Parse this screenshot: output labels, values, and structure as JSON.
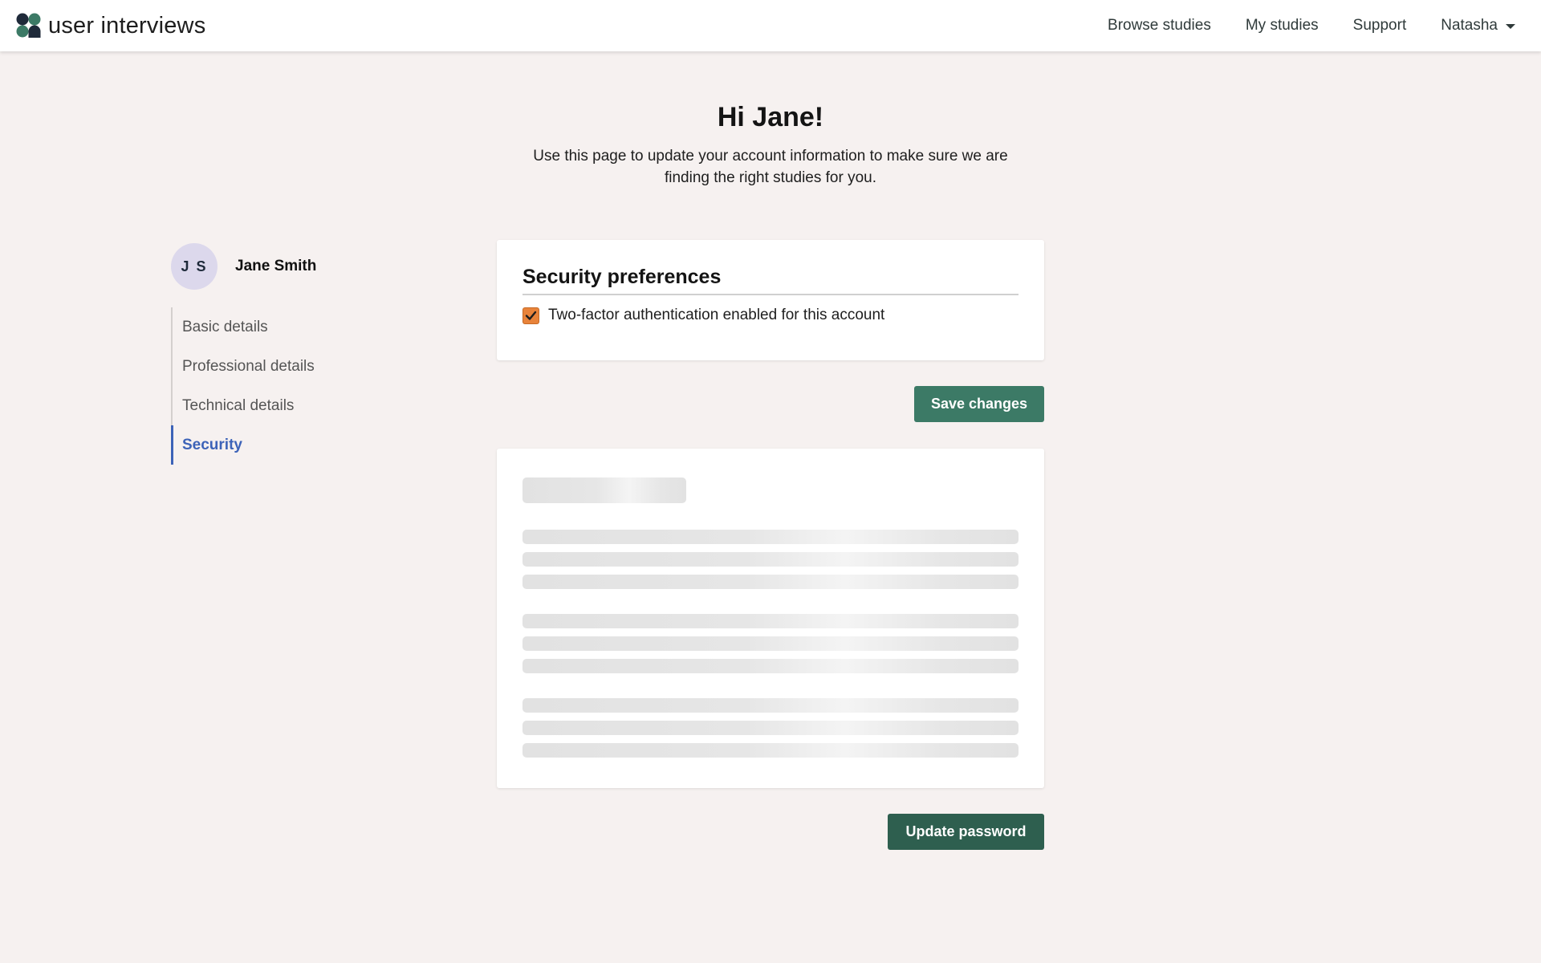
{
  "app": {
    "brand_name": "user interviews",
    "logo": {
      "icon": "user-interviews-logo-icon",
      "colors": [
        "#1f2a3a",
        "#3c7a66"
      ]
    }
  },
  "nav": {
    "links": [
      "Browse studies",
      "My studies",
      "Support"
    ],
    "user_menu": {
      "label": "Natasha",
      "icon": "chevron-down-icon"
    }
  },
  "header": {
    "greeting": "Hi Jane!",
    "intro": "Use this page to update your account information to make sure we are finding the right studies for you."
  },
  "profile": {
    "initials": "J S",
    "name": "Jane Smith"
  },
  "sidebar": {
    "items": [
      {
        "label": "Basic details",
        "active": false
      },
      {
        "label": "Professional details",
        "active": false
      },
      {
        "label": "Technical details",
        "active": false
      },
      {
        "label": "Security",
        "active": true
      }
    ]
  },
  "security": {
    "title": "Security preferences",
    "two_factor": {
      "label": "Two-factor authentication enabled for this account",
      "checked": true,
      "icon": "checkmark-icon"
    },
    "save_label": "Save changes"
  },
  "password": {
    "loading": true,
    "update_label": "Update password"
  },
  "colors": {
    "page_background": "#f6f1f0",
    "active_nav": "#3d63b8",
    "primary_button": "#3c7a66",
    "checkbox_fill": "#e8833a",
    "avatar_background": "#dcd8ec"
  }
}
